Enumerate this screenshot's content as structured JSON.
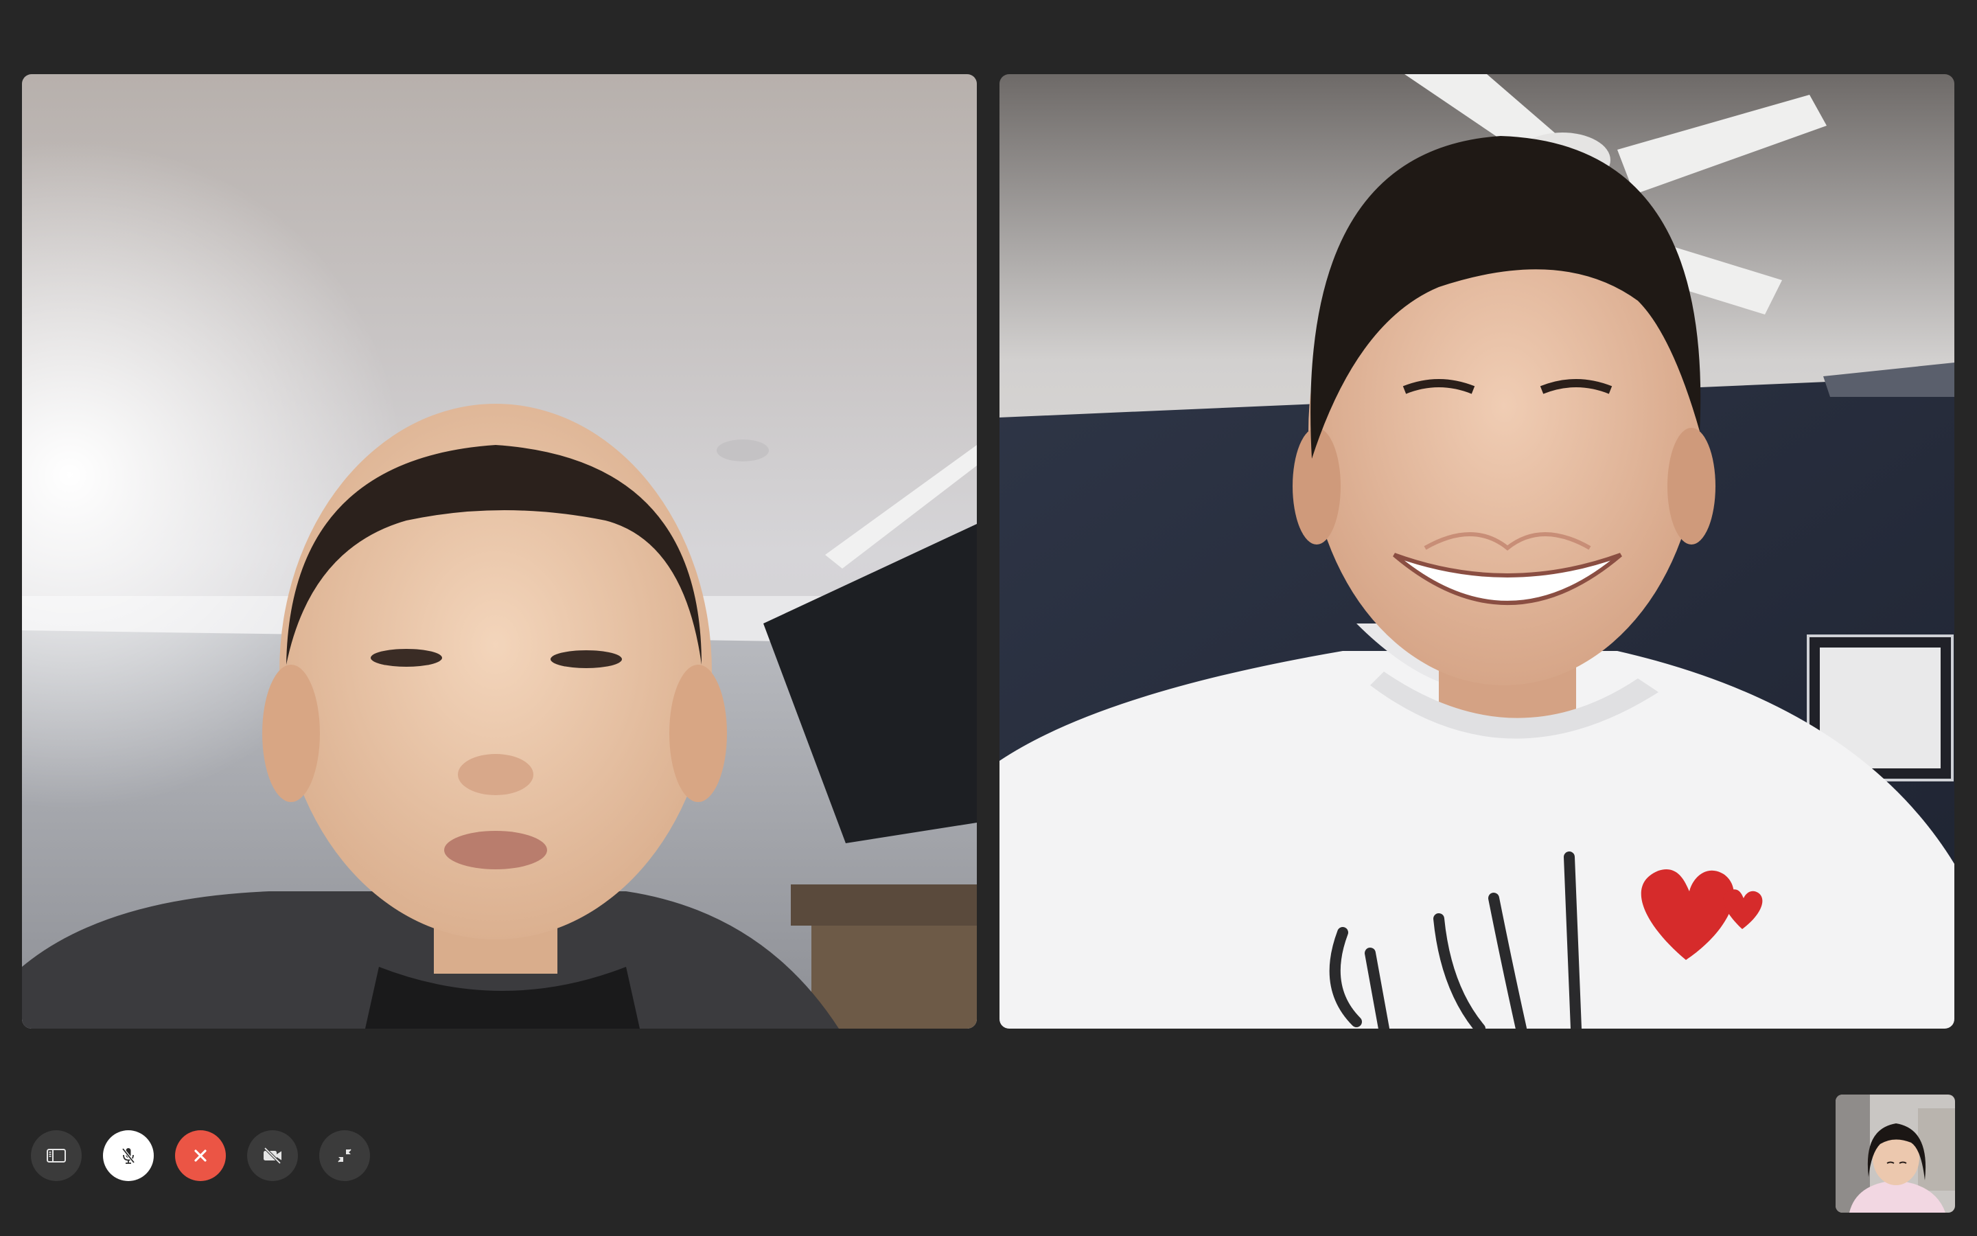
{
  "call": {
    "participants": [
      {
        "name": "participant-1",
        "role": "remote"
      },
      {
        "name": "participant-2",
        "role": "remote"
      }
    ],
    "self_view": {
      "role": "local"
    }
  },
  "controls": [
    {
      "name": "sidebar-toggle-button",
      "icon": "sidebar-icon",
      "state": "default"
    },
    {
      "name": "mute-button",
      "icon": "mic-slash-icon",
      "state": "muted"
    },
    {
      "name": "end-call-button",
      "icon": "close-icon",
      "state": "danger"
    },
    {
      "name": "video-toggle-button",
      "icon": "video-slash-icon",
      "state": "default"
    },
    {
      "name": "exit-fullscreen-button",
      "icon": "collapse-arrows-icon",
      "state": "default"
    }
  ],
  "colors": {
    "background": "#262626",
    "control_default": "#3b3b3b",
    "control_muted": "#ffffff",
    "control_end": "#eb5545"
  }
}
